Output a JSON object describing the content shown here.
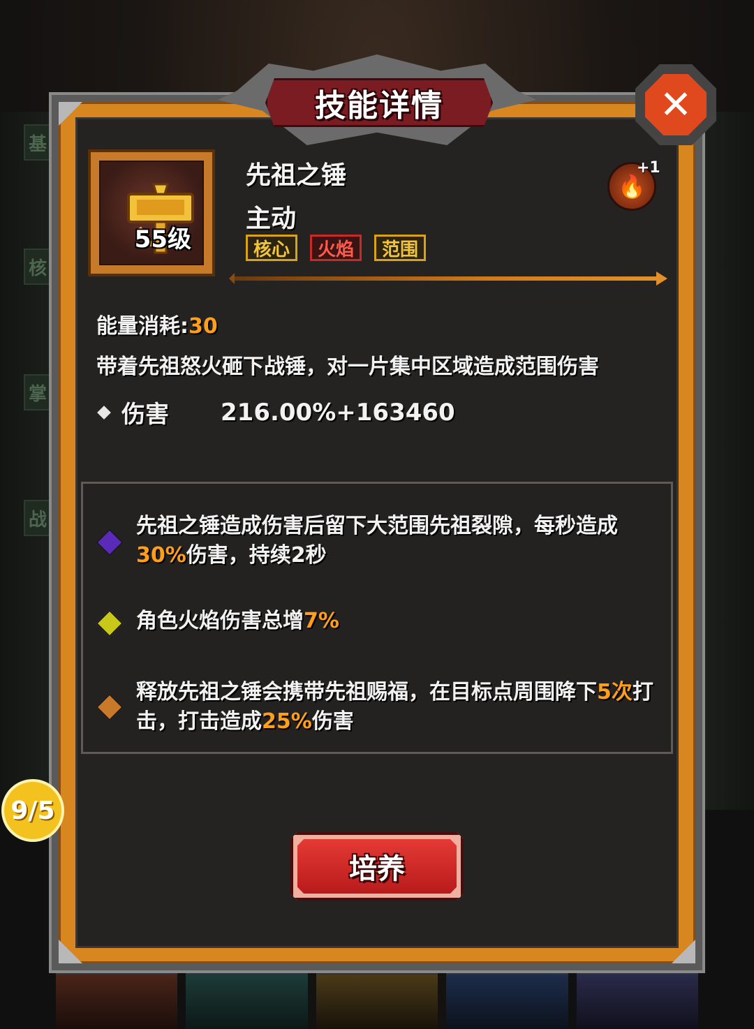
{
  "title": "技能详情",
  "side_tabs": [
    "基",
    "核",
    "掌",
    "战"
  ],
  "skill": {
    "name": "先祖之锤",
    "type": "主动",
    "level": "55级",
    "tags": [
      "核心",
      "火焰",
      "范围"
    ],
    "element_icon": "fire-icon",
    "element_bonus": "+1",
    "energy_label": "能量消耗:",
    "energy_value": "30",
    "description": "带着先祖怒火砸下战锤，对一片集中区域造成范围伤害",
    "stat_label": "伤害",
    "stat_value": "216.00%+163460"
  },
  "effects": [
    {
      "gem_color": "#5a2ab8",
      "text_a": "先祖之锤造成伤害后留下大范围先祖裂隙，每秒造成",
      "hl_a": "30%",
      "text_b": "伤害，持续2秒"
    },
    {
      "gem_color": "#c8c81a",
      "text_a": "角色火焰伤害总增",
      "hl_a": "7%",
      "text_b": ""
    },
    {
      "gem_color": "#c87a2a",
      "text_a": "释放先祖之锤会携带先祖赐福，在目标点周围降下",
      "hl_a": "5次",
      "text_b": "打击，打击造成",
      "hl_b": "25%",
      "text_c": "伤害"
    }
  ],
  "counter": "9/5",
  "button_label": "培养",
  "close_icon": "close-icon",
  "colors": {
    "accent_orange": "#ff9e1a",
    "frame_orange": "#d8861f",
    "button_red": "#d62a28",
    "close_orange": "#e0481d"
  }
}
